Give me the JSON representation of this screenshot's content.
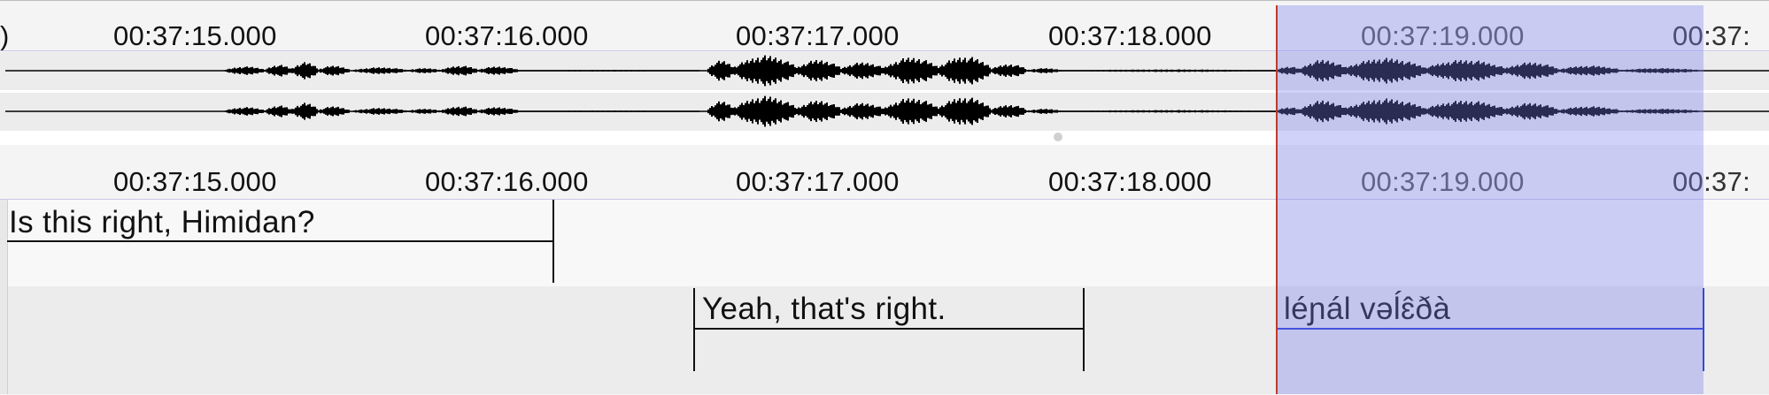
{
  "timeline": {
    "ticks": [
      "00:37:15.000",
      "00:37:16.000",
      "00:37:17.000",
      "00:37:18.000",
      "00:37:19.000",
      "00:37:"
    ]
  },
  "annotations": {
    "tier1": [
      {
        "text": "Is this right, Himidan?"
      }
    ],
    "tier2": [
      {
        "text": "Yeah, that's right."
      },
      {
        "text": "léɲál vəĺɛ̂ðà"
      }
    ]
  },
  "colors": {
    "selection": "#787df0",
    "crosshair": "#c0392b",
    "waveform": "#000000",
    "waveform_selected": "#8a8aa8"
  }
}
